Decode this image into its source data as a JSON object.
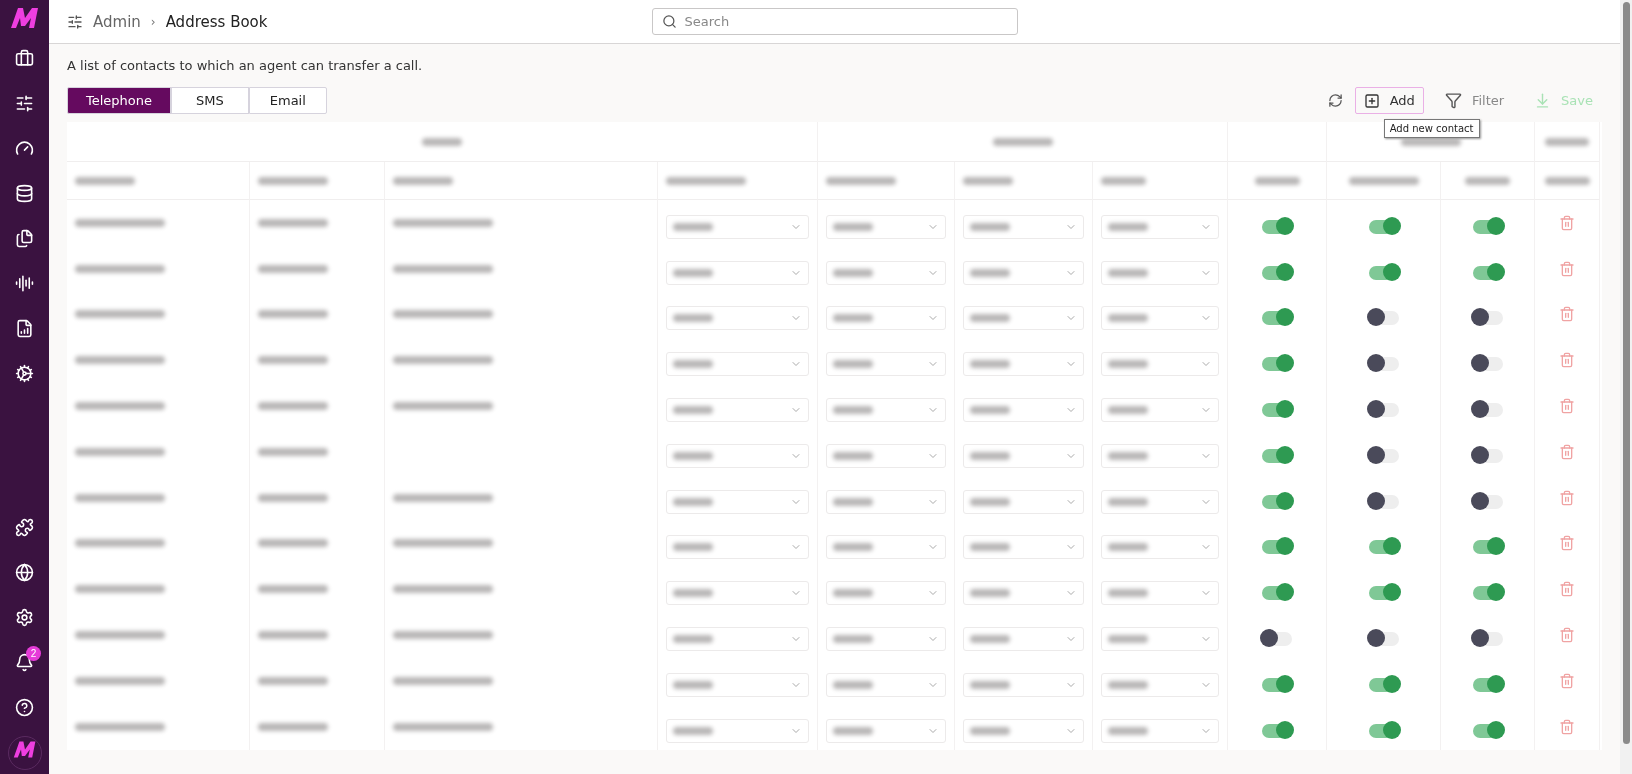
{
  "breadcrumb": {
    "parent": "Admin",
    "separator": "›",
    "current": "Address Book"
  },
  "search": {
    "placeholder": "Search"
  },
  "sidebar": {
    "notification_badge": "2"
  },
  "description": "A list of contacts to which an agent can transfer a call.",
  "tabs": [
    {
      "label": "Telephone",
      "selected": true
    },
    {
      "label": "SMS",
      "selected": false
    },
    {
      "label": "Email",
      "selected": false
    }
  ],
  "toolbar": {
    "add": "Add",
    "filter": "Filter",
    "save": "Save",
    "save_disabled": true,
    "tooltip": "Add new contact"
  },
  "rows": [
    {
      "hold": true,
      "conference": true,
      "bridge": true
    },
    {
      "hold": true,
      "conference": true,
      "bridge": true
    },
    {
      "hold": true,
      "conference": false,
      "bridge": false
    },
    {
      "hold": true,
      "conference": false,
      "bridge": false
    },
    {
      "hold": true,
      "conference": false,
      "bridge": false
    },
    {
      "hold": true,
      "conference": false,
      "bridge": false
    },
    {
      "hold": true,
      "conference": false,
      "bridge": false
    },
    {
      "hold": true,
      "conference": true,
      "bridge": true
    },
    {
      "hold": true,
      "conference": true,
      "bridge": true
    },
    {
      "hold": false,
      "conference": false,
      "bridge": false
    },
    {
      "hold": true,
      "conference": true,
      "bridge": true
    },
    {
      "hold": true,
      "conference": true,
      "bridge": true
    }
  ]
}
